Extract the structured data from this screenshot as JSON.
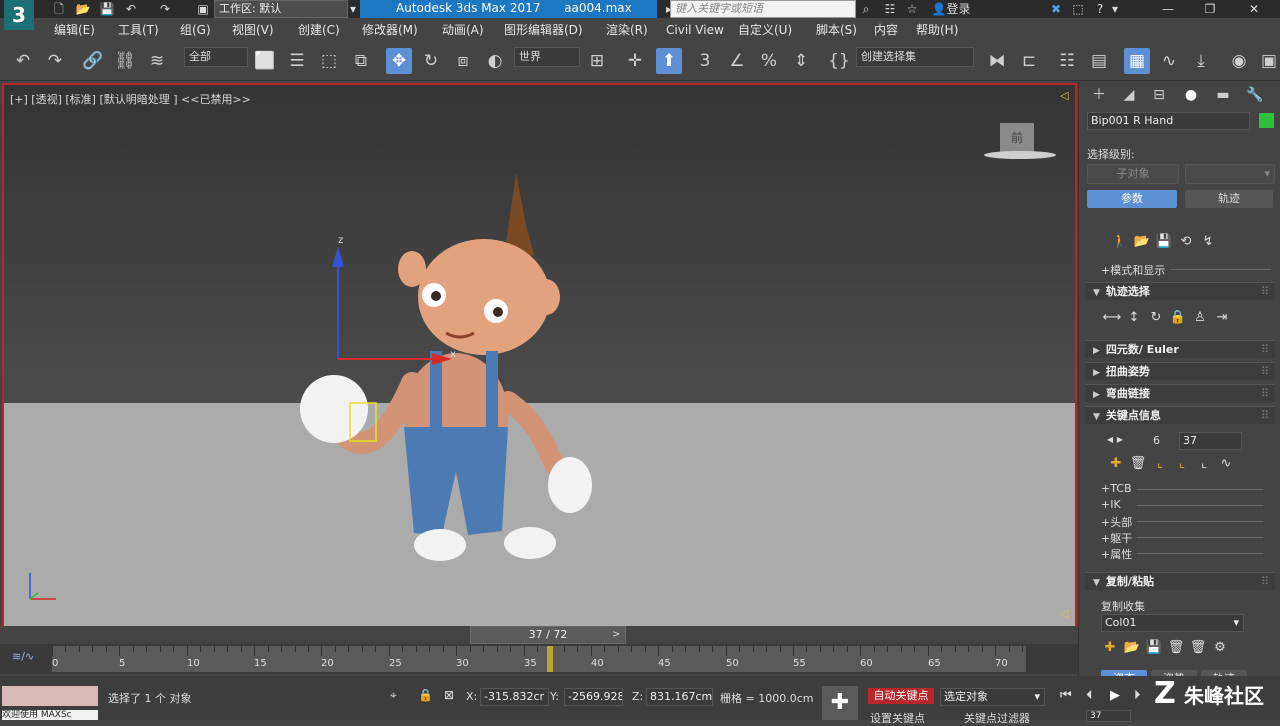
{
  "title_bar": {
    "logo": "3",
    "workspace_label": "工作区: 默认",
    "app_title": "Autodesk 3ds Max 2017",
    "file_name": "aa004.max",
    "search_placeholder": "键入关键字或短语",
    "signin": "登录",
    "help": "?"
  },
  "menu": [
    "编辑(E)",
    "工具(T)",
    "组(G)",
    "视图(V)",
    "创建(C)",
    "修改器(M)",
    "动画(A)",
    "图形编辑器(D)",
    "渲染(R)",
    "Civil View",
    "自定义(U)",
    "脚本(S)",
    "内容",
    "帮助(H)"
  ],
  "toolbar": {
    "selection_filter": "全部",
    "ref_coord": "世界",
    "named_selection": "创建选择集"
  },
  "viewport": {
    "label": "[+] [透视] [标准] [默认明暗处理 ] <<已禁用>>",
    "viewcube_face": "前",
    "gizmo_axis_z": "z",
    "gizmo_axis_x": "x"
  },
  "command_panel": {
    "object_name": "Bip001 R Hand",
    "object_color": "#2ec23a",
    "selection_level_label": "选择级别:",
    "sub_object_btn": "子对象",
    "params_btn": "参数",
    "trajectory_btn": "轨迹",
    "mode_display": "+模式和显示",
    "rollouts": {
      "track_select": "轨迹选择",
      "quat_euler": "四元数/ Euler",
      "twist_pose": "扭曲姿势",
      "bend_links": "弯曲链接",
      "key_info": "关键点信息",
      "copy_paste": "复制/粘贴"
    },
    "key_number": "6",
    "key_time": "37",
    "key_subitems": [
      "+TCB",
      "+IK",
      "+头部",
      "+躯干",
      "+属性"
    ],
    "copy_collection_label": "复制收集",
    "copy_collection_value": "Col01",
    "bottom_tabs": [
      "姿态",
      "姿势",
      "轨迹"
    ]
  },
  "timeline": {
    "frame_indicator": "37 / 72",
    "current_frame": 37,
    "total_frames": 72,
    "ticks": [
      "0",
      "5",
      "10",
      "15",
      "20",
      "25",
      "30",
      "35",
      "40",
      "45",
      "50",
      "55",
      "60",
      "65",
      "70"
    ]
  },
  "status": {
    "maxscript": "欢迎使用 MAXSc",
    "selected_msg": "选择了 1 个 对象",
    "x_label": "X:",
    "x_value": "-315.832cr",
    "y_label": "Y:",
    "y_value": "-2569.928",
    "z_label": "Z:",
    "z_value": "831.167cm",
    "grid": "栅格 = 1000.0cm",
    "auto_key": "自动关键点",
    "set_key": "设置关键点",
    "selected_obj": "选定对象",
    "key_filters": "关键点过滤器",
    "frame": "37"
  },
  "watermark": "朱峰社区"
}
